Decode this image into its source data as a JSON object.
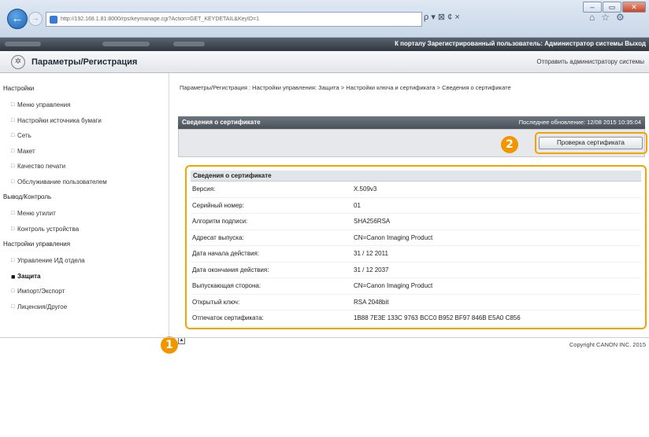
{
  "browser": {
    "url": "http://192.168.1.81:8000/rps/keymanage.cgi?Action=GET_KEYDETAIL&KeyID=1",
    "search_label": "ρ ▾ ⊠ ¢ ×",
    "home_icon": "home-icon",
    "star_icon": "star-icon",
    "gear_icon": "gear-icon"
  },
  "topbar": {
    "right_text": "К порталу   Зарегистрированный пользователь: Администратор системы  Выход"
  },
  "header": {
    "title": "Параметры/Регистрация",
    "send_link": "Отправить администратору системы"
  },
  "sidebar": {
    "sections": [
      {
        "label": "Настройки",
        "items": [
          {
            "label": "Меню управления",
            "active": false
          },
          {
            "label": "Настройки источника бумаги",
            "active": false
          },
          {
            "label": "Сеть",
            "active": false
          },
          {
            "label": "Макет",
            "active": false
          },
          {
            "label": "Качество печати",
            "active": false
          },
          {
            "label": "Обслуживание пользователем",
            "active": false
          }
        ]
      },
      {
        "label": "Вывод/Контроль",
        "items": [
          {
            "label": "Меню утилит",
            "active": false
          },
          {
            "label": "Контроль устройства",
            "active": false
          }
        ]
      },
      {
        "label": "Настройки управления",
        "items": [
          {
            "label": "Управление ИД отдела",
            "active": false
          },
          {
            "label": "Защита",
            "active": true
          },
          {
            "label": "Импорт/Экспорт",
            "active": false
          },
          {
            "label": "Лицензия/Другое",
            "active": false
          }
        ]
      }
    ]
  },
  "main": {
    "breadcrumb": "Параметры/Регистрация : Настройки управления: Защита > Настройки ключа и сертификата > Сведения о сертификате",
    "panel_title": "Сведения о сертификате",
    "last_updated": "Последнее обновление: 12/08 2015 10:35:04",
    "check_button": "Проверка сертификата",
    "badge_1": "1",
    "badge_2": "2",
    "info_header": "Сведения о сертификате",
    "info_rows": [
      {
        "k": "Версия:",
        "v": "X.509v3"
      },
      {
        "k": "Серийный номер:",
        "v": "01"
      },
      {
        "k": "Алгоритм подписи:",
        "v": "SHA256RSA"
      },
      {
        "k": "Адресат выпуска:",
        "v": "CN=Canon Imaging Product"
      },
      {
        "k": "Дата начала действия:",
        "v": "31 / 12 2011"
      },
      {
        "k": "Дата окончания действия:",
        "v": "31 / 12 2037"
      },
      {
        "k": "Выпускающая сторона:",
        "v": "CN=Canon Imaging Product"
      },
      {
        "k": "Открытый ключ:",
        "v": "RSA 2048bit"
      },
      {
        "k": "Отпечаток сертификата:",
        "v": "1B88 7E3E 133C 9763 BCC0 B952 BF97 846B E5A0 C856"
      }
    ]
  },
  "footer": {
    "copyright": "Copyright CANON INC. 2015"
  }
}
